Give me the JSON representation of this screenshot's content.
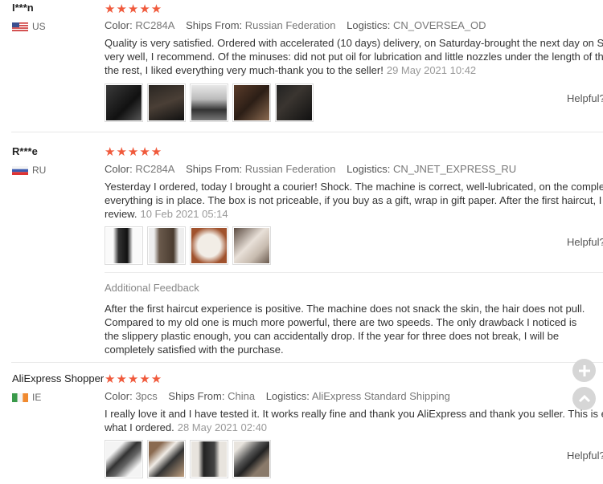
{
  "reviews": [
    {
      "user": "I***n",
      "country": "US",
      "color_label": "Color:",
      "color": "RC284A",
      "ships_label": "Ships From:",
      "ships": "Russian Federation",
      "logistics_label": "Logistics:",
      "logistics": "CN_OVERSEA_OD",
      "text_lines": [
        "Quality is very satisfied. Ordered with accelerated (10 days) delivery, on Saturday-brought the next day on Sunda",
        "very well, I recommend. Of the minuses: did not put oil for lubrication and little nozzles under the length of the",
        "the rest, I liked everything very much-thank you to the seller!"
      ],
      "date": "29 May 2021 10:42",
      "helpful": "Helpful?"
    },
    {
      "user": "R***e",
      "country": "RU",
      "color_label": "Color:",
      "color": "RC284A",
      "ships_label": "Ships From:",
      "ships": "Russian Federation",
      "logistics_label": "Logistics:",
      "logistics": "CN_JNET_EXPRESS_RU",
      "text_lines": [
        "Yesterday I ordered, today I brought a courier! Shock. The machine is correct, well-lubricated, on the complete s",
        "everything is in place. The box is not priceable, if you buy as a gift, wrap in gift paper. After the first haircut, I will",
        "review."
      ],
      "date": "10 Feb 2021 05:14",
      "helpful": "Helpful?",
      "additional_feedback_title": "Additional Feedback",
      "additional_feedback": "After the first haircut experience is positive. The machine does not snack the skin, the hair does not pull. Compared to my old one is much more powerful, there are two speeds. The only drawback I noticed is the slippery plastic enough, you can accidentally drop. If the year for three does not break, I will be completely satisfied with the purchase."
    },
    {
      "user": "AliExpress Shopper",
      "country": "IE",
      "color_label": "Color:",
      "color": "3pcs",
      "ships_label": "Ships From:",
      "ships": "China",
      "logistics_label": "Logistics:",
      "logistics": "AliExpress Standard Shipping",
      "text_lines": [
        "I really love it and I have tested it. It works really fine and thank you AliExpress and thank you seller. This is exac",
        "what I ordered."
      ],
      "date": "28 May 2021 02:40",
      "helpful": "Helpful?"
    }
  ],
  "stars": "★★★★★",
  "float_buttons": {
    "add_icon": "plus-icon",
    "top_icon": "chevron-up-icon"
  }
}
